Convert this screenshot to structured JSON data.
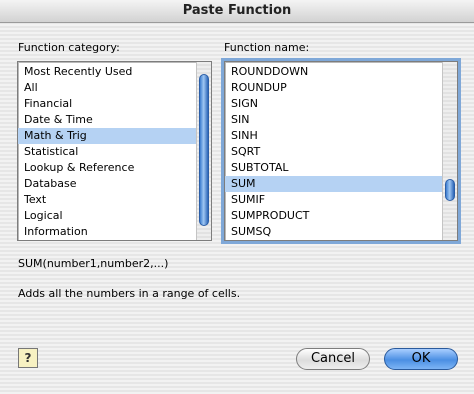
{
  "window": {
    "title": "Paste Function"
  },
  "category": {
    "label": "Function category:",
    "items": [
      "Most Recently Used",
      "All",
      "Financial",
      "Date & Time",
      "Math & Trig",
      "Statistical",
      "Lookup & Reference",
      "Database",
      "Text",
      "Logical",
      "Information"
    ],
    "selected": "Math & Trig"
  },
  "function": {
    "label": "Function name:",
    "items": [
      "ROUNDDOWN",
      "ROUNDUP",
      "SIGN",
      "SIN",
      "SINH",
      "SQRT",
      "SUBTOTAL",
      "SUM",
      "SUMIF",
      "SUMPRODUCT",
      "SUMSQ"
    ],
    "selected": "SUM"
  },
  "syntax": "SUM(number1,number2,...)",
  "description": "Adds all the numbers in a range of cells.",
  "buttons": {
    "help": "?",
    "cancel": "Cancel",
    "ok": "OK"
  },
  "colors": {
    "selection": "#b5d2f3",
    "ok_button": "#4b8fe3"
  },
  "icons": {
    "help": "help-icon"
  }
}
